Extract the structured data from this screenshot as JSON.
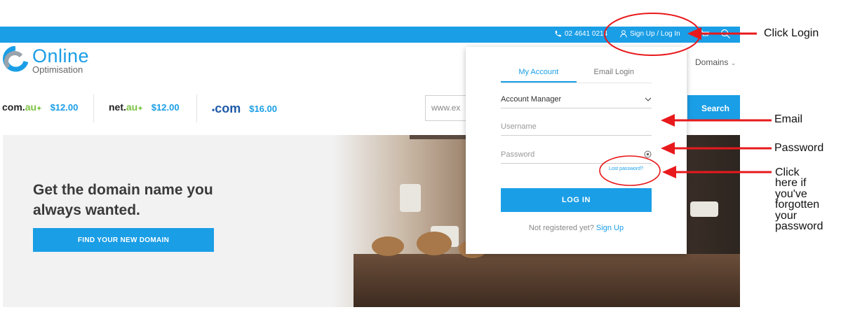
{
  "topbar": {
    "phone": "02 4641 0214",
    "login_label": "Sign Up / Log In"
  },
  "header": {
    "logo_word1": "Online",
    "logo_word2": "Optimisation",
    "nav_domains": "Domains"
  },
  "prices": [
    {
      "tld_main": "com.",
      "tld_accent": "au",
      "price": "$12.00"
    },
    {
      "tld_main": "net.",
      "tld_accent": "au",
      "price": "$12.00"
    },
    {
      "tld_main": "com",
      "tld_accent": "",
      "price": "$16.00"
    }
  ],
  "domain_search": {
    "placeholder": "www.ex",
    "button": "Search"
  },
  "hero": {
    "headline": "Get the domain name you always wanted.",
    "button": "FIND YOUR NEW DOMAIN"
  },
  "login_panel": {
    "tabs": [
      {
        "label": "My Account",
        "active": true
      },
      {
        "label": "Email Login",
        "active": false
      }
    ],
    "account_type": "Account Manager",
    "username_placeholder": "Username",
    "password_placeholder": "Password",
    "lost_password": "Lost password?",
    "login_button": "LOG IN",
    "not_registered": "Not registered yet?",
    "sign_up": "Sign Up"
  },
  "annotations": {
    "click_login": "Click Login",
    "email": "Email",
    "password": "Password",
    "lost_help": [
      "Click",
      "here if",
      "you've",
      "forgotten",
      "your",
      "password"
    ]
  },
  "colors": {
    "brand_blue": "#1a9ee6",
    "annotation_red": "#e8191c",
    "au_green": "#7cc242"
  }
}
